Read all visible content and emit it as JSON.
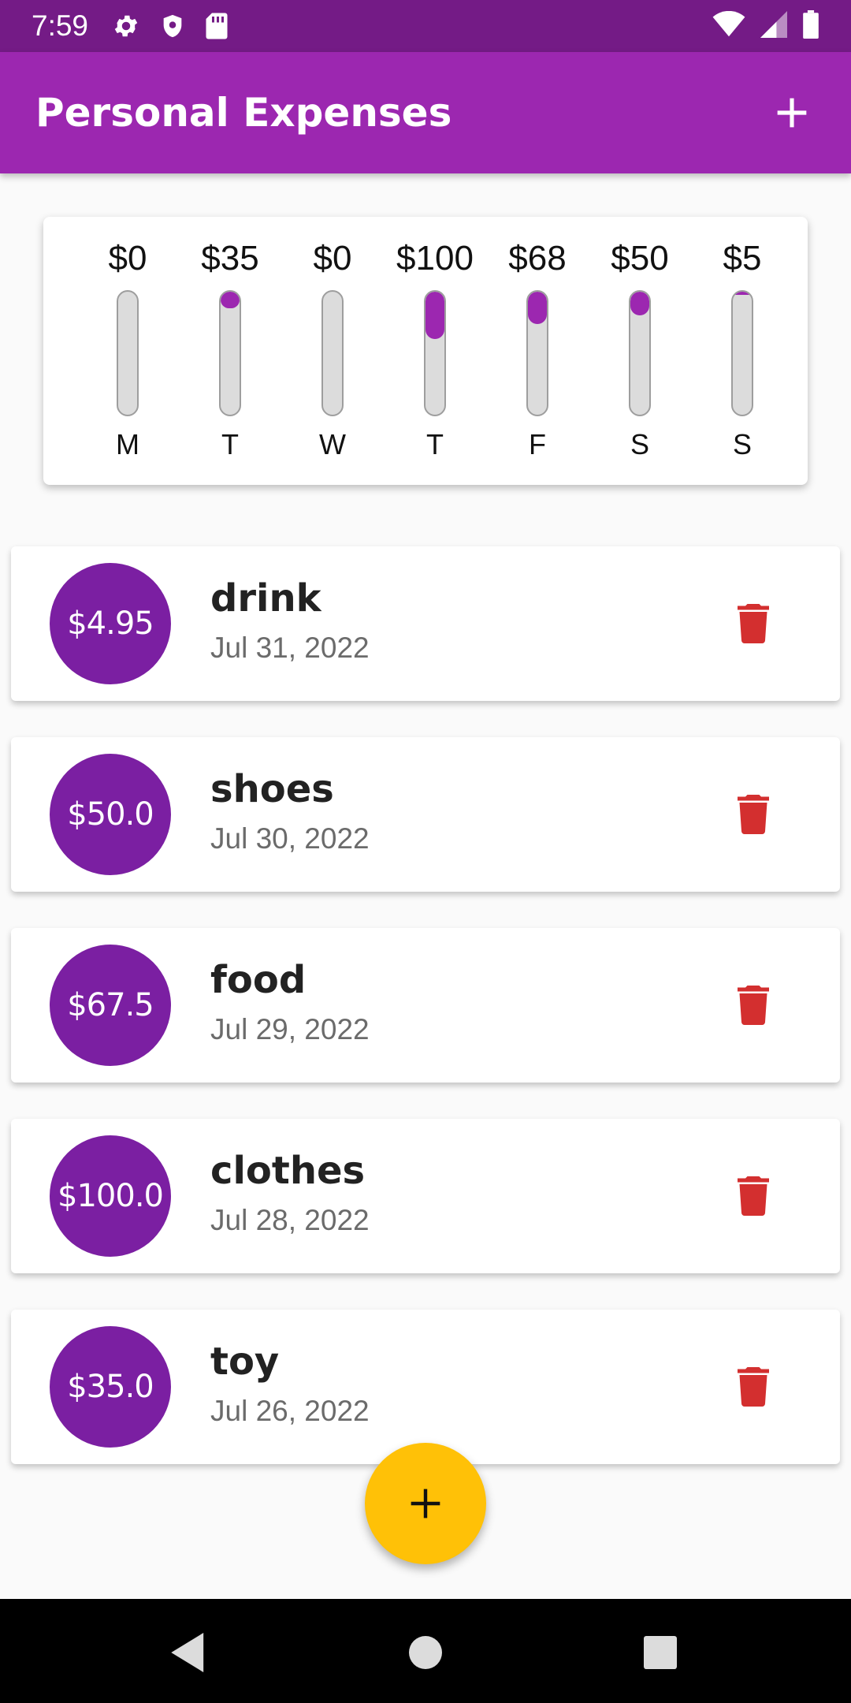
{
  "status_bar": {
    "time": "7:59",
    "left_icons": [
      "settings-icon",
      "shield-icon",
      "sd-card-icon"
    ],
    "right_icons": [
      "wifi-icon",
      "signal-icon",
      "battery-icon"
    ],
    "background": "#741b86"
  },
  "app_bar": {
    "title": "Personal Expenses",
    "action_icon": "add-icon",
    "background": "#9c27b0"
  },
  "chart": {
    "days": [
      {
        "label": "M",
        "amount": "$0",
        "fraction": 0.0
      },
      {
        "label": "T",
        "amount": "$35",
        "fraction": 0.136
      },
      {
        "label": "W",
        "amount": "$0",
        "fraction": 0.0
      },
      {
        "label": "T",
        "amount": "$100",
        "fraction": 0.385
      },
      {
        "label": "F",
        "amount": "$68",
        "fraction": 0.262
      },
      {
        "label": "S",
        "amount": "$50",
        "fraction": 0.193
      },
      {
        "label": "S",
        "amount": "$5",
        "fraction": 0.019
      }
    ],
    "fill_color": "#9c27b0",
    "track_color": "#dcdcdc"
  },
  "expenses": [
    {
      "amount": "$4.95",
      "title": "drink",
      "date": "Jul 31, 2022"
    },
    {
      "amount": "$50.0",
      "title": "shoes",
      "date": "Jul 30, 2022"
    },
    {
      "amount": "$67.5",
      "title": "food",
      "date": "Jul 29, 2022"
    },
    {
      "amount": "$100.0",
      "title": "clothes",
      "date": "Jul 28, 2022"
    },
    {
      "amount": "$35.0",
      "title": "toy",
      "date": "Jul 26, 2022"
    }
  ],
  "fab": {
    "icon": "add-icon",
    "color": "#ffc107"
  },
  "nav_bar": {
    "buttons": [
      "back-icon",
      "home-icon",
      "recents-icon"
    ]
  },
  "colors": {
    "delete": "#d32f2f",
    "amount_circle": "#7b1fa2"
  }
}
